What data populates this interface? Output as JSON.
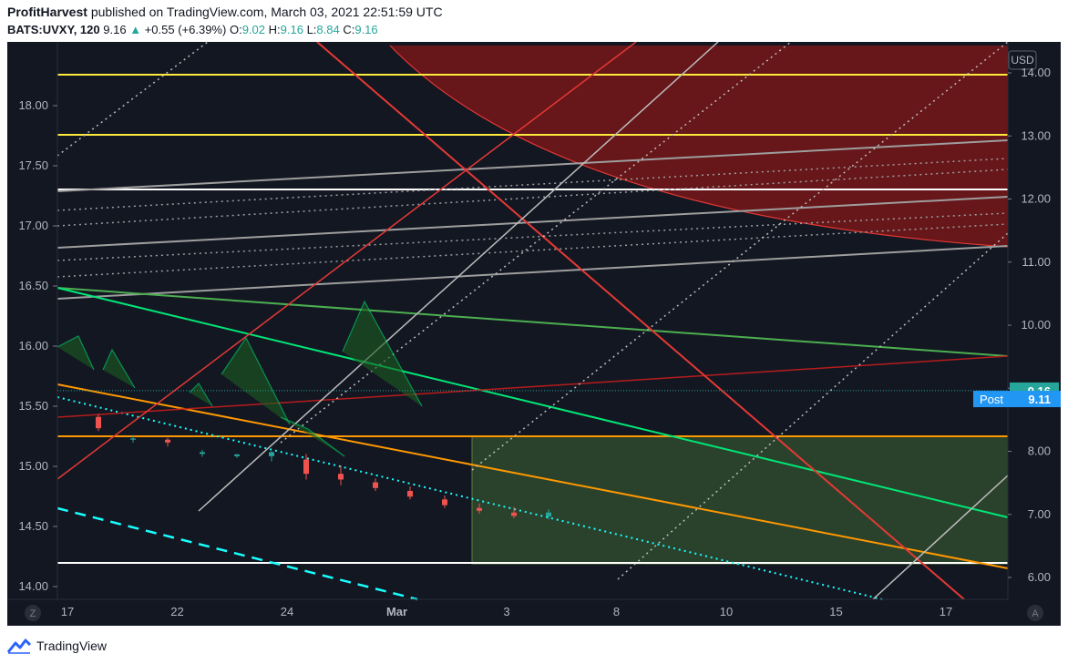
{
  "header": {
    "author": "ProfitHarvest",
    "published_text": "published on TradingView.com, March 03, 2021 22:51:59 UTC",
    "symbol": "BATS:UVXY, 120",
    "last": "9.16",
    "change_arrow": "▲",
    "change": "+0.55 (+6.39%)",
    "o_label": "O:",
    "o_value": "9.02",
    "h_label": "H:",
    "h_value": "9.16",
    "l_label": "L:",
    "l_value": "8.84",
    "c_label": "C:",
    "c_value": "9.16"
  },
  "footer": {
    "brand": "TradingView"
  },
  "chart_data": {
    "type": "candlestick",
    "currency_label": "USD",
    "left_axis": {
      "ticks": [
        "18.00",
        "17.50",
        "17.00",
        "16.50",
        "16.00",
        "15.50",
        "15.00",
        "14.50",
        "14.00"
      ],
      "range": [
        13.92,
        18.55
      ]
    },
    "right_axis": {
      "ticks": [
        "14.00",
        "13.00",
        "12.00",
        "11.00",
        "10.00",
        "9.00",
        "8.00",
        "7.00",
        "6.00"
      ],
      "range": [
        5.88,
        14.74
      ]
    },
    "x_axis": {
      "ticks": [
        "17",
        "22",
        "24",
        "Mar",
        "3",
        "8",
        "10",
        "15",
        "17"
      ],
      "bold_ticks": [
        "Mar"
      ]
    },
    "price_labels": [
      {
        "text": "9.16",
        "color": "#26a69a"
      },
      {
        "tag": "Post",
        "text": "9.11",
        "color": "#2196f3"
      }
    ],
    "candles": [
      {
        "o": 8.7,
        "h": 8.75,
        "l": 8.45,
        "c": 8.5
      },
      {
        "o": 8.3,
        "h": 8.38,
        "l": 8.25,
        "c": 8.32
      },
      {
        "o": 8.3,
        "h": 8.33,
        "l": 8.18,
        "c": 8.25
      },
      {
        "o": 8.05,
        "h": 8.12,
        "l": 8.0,
        "c": 8.08
      },
      {
        "o": 8.01,
        "h": 8.05,
        "l": 7.98,
        "c": 8.04
      },
      {
        "o": 8.01,
        "h": 8.1,
        "l": 7.92,
        "c": 8.08
      },
      {
        "o": 7.95,
        "h": 8.05,
        "l": 7.6,
        "c": 7.7
      },
      {
        "o": 7.7,
        "h": 7.85,
        "l": 7.5,
        "c": 7.6
      },
      {
        "o": 7.55,
        "h": 7.62,
        "l": 7.4,
        "c": 7.45
      },
      {
        "o": 7.4,
        "h": 7.48,
        "l": 7.25,
        "c": 7.3
      },
      {
        "o": 7.25,
        "h": 7.32,
        "l": 7.1,
        "c": 7.15
      },
      {
        "o": 7.1,
        "h": 7.18,
        "l": 7.0,
        "c": 7.05
      },
      {
        "o": 7.02,
        "h": 7.12,
        "l": 6.92,
        "c": 6.96
      },
      {
        "o": 6.95,
        "h": 7.08,
        "l": 6.9,
        "c": 7.02
      }
    ],
    "candles_src_note": "",
    "horizontal_levels": [],
    "annotations": []
  }
}
